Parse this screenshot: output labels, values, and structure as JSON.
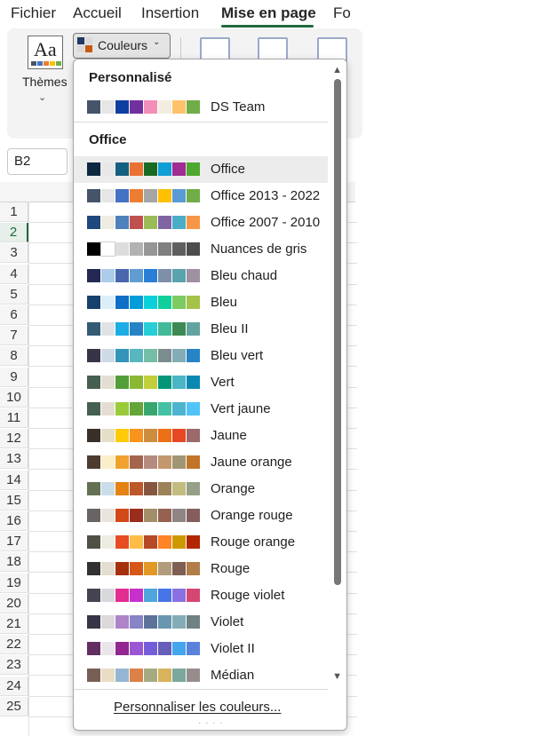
{
  "ribbon": {
    "tabs": [
      {
        "label": "Fichier"
      },
      {
        "label": "Accueil"
      },
      {
        "label": "Insertion"
      },
      {
        "label": "Mise en page"
      },
      {
        "label": "Fo"
      }
    ],
    "themes_label": "Thèmes",
    "themes_icon_text": "Aa",
    "couleurs_label": "Couleurs"
  },
  "namebox": {
    "value": "B2"
  },
  "rows": [
    "1",
    "2",
    "3",
    "4",
    "5",
    "6",
    "7",
    "8",
    "9",
    "10",
    "11",
    "12",
    "13",
    "14",
    "15",
    "16",
    "17",
    "18",
    "19",
    "20",
    "21",
    "22",
    "23",
    "24",
    "25"
  ],
  "dropdown": {
    "section_custom": "Personnalisé",
    "section_office": "Office",
    "custom_items": [
      {
        "label": "DS Team",
        "colors": [
          "#44546a",
          "#e7e6e6",
          "#0f3fa0",
          "#7030a0",
          "#f28fb8",
          "#f3ede0",
          "#ffc26b",
          "#70ad47"
        ]
      }
    ],
    "office_items": [
      {
        "label": "Office",
        "colors": [
          "#0e2841",
          "#e8e8e8",
          "#156082",
          "#e97132",
          "#196b24",
          "#0f9ed5",
          "#a02b93",
          "#4ea72e"
        ]
      },
      {
        "label": "Office 2013 - 2022",
        "colors": [
          "#44546a",
          "#e7e6e6",
          "#4472c4",
          "#ed7d31",
          "#a5a5a5",
          "#ffc000",
          "#5b9bd5",
          "#70ad47"
        ]
      },
      {
        "label": "Office 2007 - 2010",
        "colors": [
          "#1f497d",
          "#eeece1",
          "#4f81bd",
          "#c0504d",
          "#9bbb59",
          "#8064a2",
          "#4bacc6",
          "#f79646"
        ]
      },
      {
        "label": "Nuances de gris",
        "colors": [
          "#000000",
          "#ffffff",
          "#dddddd",
          "#b2b2b2",
          "#969696",
          "#808080",
          "#5f5f5f",
          "#4d4d4d"
        ]
      },
      {
        "label": "Bleu chaud",
        "colors": [
          "#242852",
          "#acccea",
          "#4a66ac",
          "#629dd1",
          "#297fd5",
          "#7f8fa9",
          "#5aa2ae",
          "#9d90a0"
        ]
      },
      {
        "label": "Bleu",
        "colors": [
          "#17406d",
          "#dbeff9",
          "#0f6fc6",
          "#009dd9",
          "#0bd0d9",
          "#10cf9b",
          "#7cca62",
          "#a5c249"
        ]
      },
      {
        "label": "Bleu II",
        "colors": [
          "#335b74",
          "#dfe3e5",
          "#1cade4",
          "#2683c6",
          "#27ced7",
          "#42ba97",
          "#3e8853",
          "#62a39f"
        ]
      },
      {
        "label": "Bleu vert",
        "colors": [
          "#373545",
          "#cedbe6",
          "#3494ba",
          "#58b6c0",
          "#75bda7",
          "#7a8c8e",
          "#84acb6",
          "#2683c6"
        ]
      },
      {
        "label": "Vert",
        "colors": [
          "#455f51",
          "#e3ded1",
          "#549e39",
          "#8ab833",
          "#c0cf3a",
          "#029676",
          "#4ab5c4",
          "#0989b1"
        ]
      },
      {
        "label": "Vert jaune",
        "colors": [
          "#455f51",
          "#e3ded1",
          "#99cb38",
          "#63a537",
          "#37a76f",
          "#44c1a3",
          "#4eb3cf",
          "#51c3f9"
        ]
      },
      {
        "label": "Jaune",
        "colors": [
          "#39302a",
          "#e5dec9",
          "#ffca08",
          "#f8931d",
          "#ce8d3e",
          "#ec7016",
          "#e64823",
          "#9c6a6a"
        ]
      },
      {
        "label": "Jaune orange",
        "colors": [
          "#4e3b30",
          "#fbeec9",
          "#f0a22e",
          "#a5644e",
          "#b58b80",
          "#c3986d",
          "#a19574",
          "#c17529"
        ]
      },
      {
        "label": "Orange",
        "colors": [
          "#637052",
          "#ccddea",
          "#e48312",
          "#bd582c",
          "#865640",
          "#9b8357",
          "#c2bc80",
          "#94a088"
        ]
      },
      {
        "label": "Orange rouge",
        "colors": [
          "#696464",
          "#e9e5dc",
          "#d34817",
          "#9b2d1f",
          "#a28e6a",
          "#956251",
          "#918485",
          "#855d5d"
        ]
      },
      {
        "label": "Rouge orange",
        "colors": [
          "#505046",
          "#eeece1",
          "#e84c22",
          "#ffbd47",
          "#b64926",
          "#ff8427",
          "#cc9900",
          "#b22600"
        ]
      },
      {
        "label": "Rouge",
        "colors": [
          "#323232",
          "#e3ded1",
          "#a5300f",
          "#d55816",
          "#e19825",
          "#b19c7d",
          "#7f5f52",
          "#b27d49"
        ]
      },
      {
        "label": "Rouge violet",
        "colors": [
          "#454551",
          "#d8d9dc",
          "#e32d91",
          "#c830cc",
          "#4ea6dc",
          "#4775e7",
          "#8971e1",
          "#d54773"
        ]
      },
      {
        "label": "Violet",
        "colors": [
          "#373545",
          "#dcd8dc",
          "#ad84c6",
          "#8784c7",
          "#5d739a",
          "#6997af",
          "#84acb6",
          "#6f8183"
        ]
      },
      {
        "label": "Violet II",
        "colors": [
          "#632e62",
          "#eae5eb",
          "#92278f",
          "#9b57d3",
          "#755dd9",
          "#665eb8",
          "#45a5ed",
          "#5982db"
        ]
      },
      {
        "label": "Médian",
        "colors": [
          "#775f55",
          "#ebddc3",
          "#94b6d2",
          "#dd8047",
          "#a5ab81",
          "#d8b25c",
          "#7ba79d",
          "#968c8c"
        ]
      }
    ],
    "footer_link": "Personnaliser les couleurs...",
    "footer_grip": "· · · ·"
  }
}
